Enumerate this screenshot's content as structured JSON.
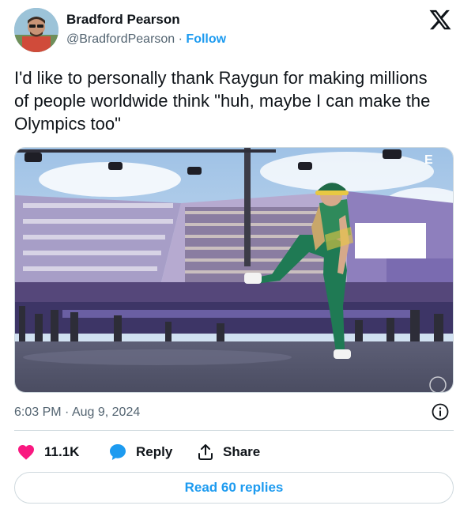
{
  "author": {
    "display_name": "Bradford Pearson",
    "handle": "@BradfordPearson",
    "separator": " · ",
    "follow_label": "Follow"
  },
  "tweet": {
    "text": "I'd like to personally thank Raygun for making millions of people worldwide think \"huh, maybe I can make the Olympics too\""
  },
  "media": {
    "watermark": "E"
  },
  "meta": {
    "time": "6:03 PM",
    "separator": " · ",
    "date": "Aug 9, 2024"
  },
  "actions": {
    "likes_count": "11.1K",
    "reply_label": "Reply",
    "share_label": "Share"
  },
  "read_replies_label": "Read 60 replies",
  "colors": {
    "accent": "#1d9bf0",
    "like": "#f91880",
    "text": "#0f1419",
    "muted": "#536471",
    "border": "#cfd9de"
  },
  "icons": [
    "x-logo-icon",
    "heart-icon",
    "reply-bubble-icon",
    "share-icon",
    "info-icon"
  ]
}
